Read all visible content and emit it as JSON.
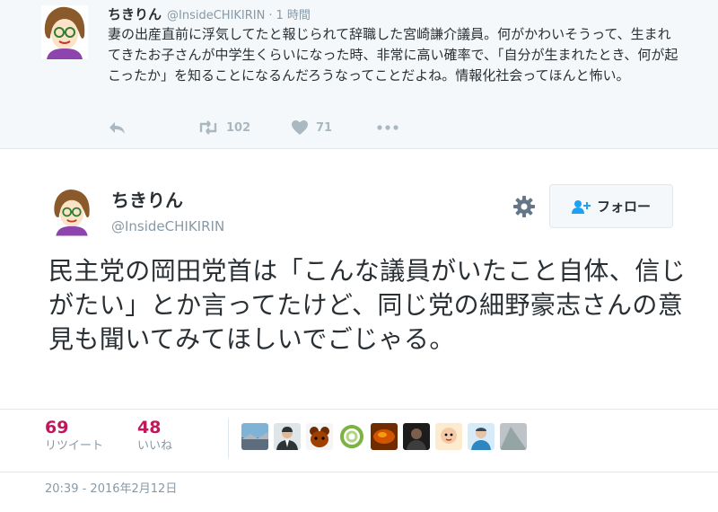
{
  "parent_tweet": {
    "name": "ちきりん",
    "handle": "@InsideCHIKIRIN",
    "separator": "·",
    "time": "1 時間",
    "text": "妻の出産直前に浮気してたと報じられて辞職した宮崎謙介議員。何がかわいそうって、生まれてきたお子さんが中学生くらいになった時、非常に高い確率で、「自分が生まれたとき、何が起こったか」を知ることになるんだろうなってことだよね。情報化社会ってほんと怖い。",
    "actions": {
      "reply_icon": "reply-icon",
      "retweet_icon": "retweet-icon",
      "retweet_count": "102",
      "like_icon": "heart-icon",
      "like_count": "71",
      "more_icon": "more-dots-icon"
    }
  },
  "tweet": {
    "name": "ちきりん",
    "handle": "@InsideCHIKIRIN",
    "follow_label": "フォロー",
    "follow_icon": "follow-person-plus-icon",
    "settings_icon": "gear-icon",
    "text": "民主党の岡田党首は「こんな議員がいたこと自体、信じがたい」とか言ってたけど、同じ党の細野豪志さんの意見も聞いてみてほしいでごじゃる。",
    "stats": {
      "retweets": {
        "count": "69",
        "label": "リツイート"
      },
      "likes": {
        "count": "48",
        "label": "いいね"
      }
    },
    "likers": [
      {
        "kind": "landscape"
      },
      {
        "kind": "person-suit"
      },
      {
        "kind": "animal"
      },
      {
        "kind": "swirl-logo"
      },
      {
        "kind": "food"
      },
      {
        "kind": "person-dark"
      },
      {
        "kind": "baby"
      },
      {
        "kind": "person-blue"
      },
      {
        "kind": "gray"
      }
    ],
    "timestamp": "20:39 - 2016年2月12日"
  },
  "colors": {
    "accent_counts": "#c2185b",
    "muted": "#8899a6",
    "parent_bg": "#f5f8fa",
    "border": "#e1e8ed"
  }
}
